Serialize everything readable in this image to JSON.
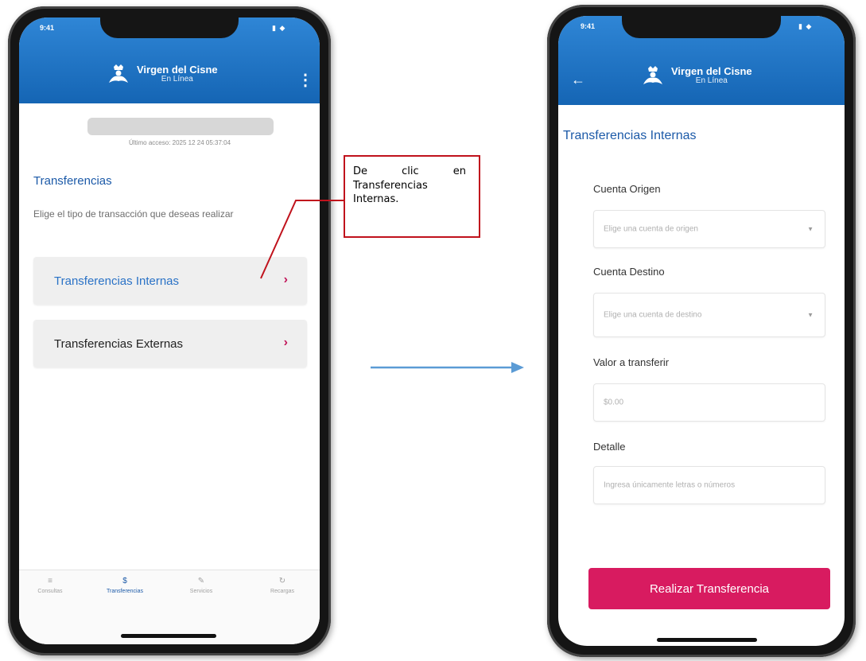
{
  "colors": {
    "brand_blue": "#1565b4",
    "accent_pink": "#d81b60",
    "callout_red": "#c0121c",
    "flow_arrow": "#5b9bd5"
  },
  "left_screen": {
    "status_time": "9:41",
    "brand": {
      "name": "Virgen del Cisne",
      "sub": "En Línea",
      "logo_icon": "virgin-crown-logo"
    },
    "menu_icon": "⋮",
    "last_access": "Último acceso: 2025 12 24 05:37:04",
    "section_title": "Transferencias",
    "hint": "Elige el tipo de transacción que deseas realizar",
    "options": [
      {
        "label": "Transferencias Internas",
        "chevron": "›"
      },
      {
        "label": "Transferencias Externas",
        "chevron": "›"
      }
    ],
    "tabs": [
      {
        "icon": "≡",
        "label": "Consultas"
      },
      {
        "icon": "$",
        "label": "Transferencias"
      },
      {
        "icon": "✎",
        "label": "Servicios"
      },
      {
        "icon": "↻",
        "label": "Recargas"
      }
    ]
  },
  "callout": {
    "text": "De clic en Transferencias Internas."
  },
  "right_screen": {
    "status_time": "9:41",
    "back_icon": "←",
    "brand": {
      "name": "Virgen del Cisne",
      "sub": "En Línea"
    },
    "title": "Transferencias Internas",
    "fields": {
      "origin": {
        "label": "Cuenta Origen",
        "placeholder": "Elige una cuenta de origen"
      },
      "destination": {
        "label": "Cuenta Destino",
        "placeholder": "Elige una cuenta de destino"
      },
      "amount": {
        "label": "Valor a transferir",
        "placeholder": "$0.00"
      },
      "detail": {
        "label": "Detalle",
        "placeholder": "Ingresa únicamente letras o números"
      }
    },
    "submit_label": "Realizar Transferencia"
  }
}
